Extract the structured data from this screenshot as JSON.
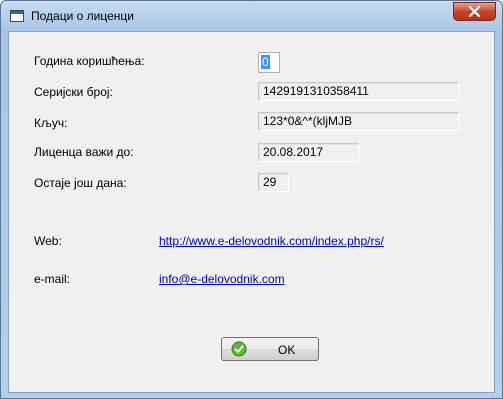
{
  "window": {
    "title": "Подаци о лиценци"
  },
  "fields": {
    "year_label": "Година коришћења:",
    "year_value": "0",
    "serial_label": "Серијски број:",
    "serial_value": "1429191310358411",
    "key_label": "Кључ:",
    "key_value": "123*0&^*(kljMJB",
    "valid_label": "Лиценца важи до:",
    "valid_value": "20.08.2017",
    "days_label": "Остаје још дана:",
    "days_value": "29"
  },
  "links": {
    "web_label": "Web:",
    "web_url": "http://www.e-delovodnik.com/index.php/rs/",
    "email_label": "e-mail:",
    "email_address": "info@e-delovodnik.com"
  },
  "buttons": {
    "ok_label": "OK"
  },
  "colors": {
    "link": "#0000cc",
    "selection": "#3399ff",
    "close": "#c7452a"
  }
}
